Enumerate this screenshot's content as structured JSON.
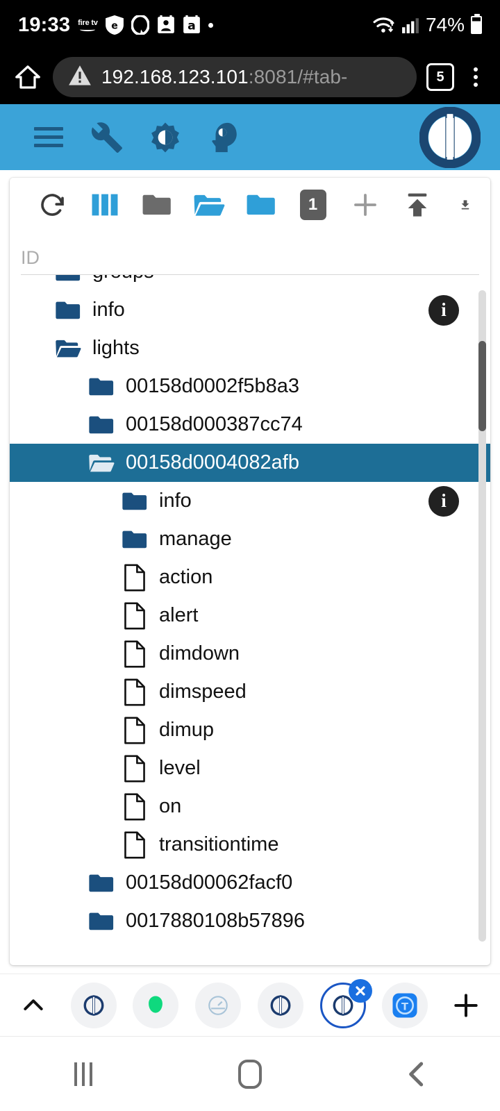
{
  "status_bar": {
    "clock": "19:33",
    "icons": [
      "firetv-icon",
      "shield-e-icon",
      "alexa-icon",
      "amazon-photos-icon",
      "amazon-a-icon",
      "dot-icon"
    ],
    "firetv_label": "fire tv",
    "wifi_icon": "wifi-icon",
    "signal_icon": "cellular-signal-icon",
    "battery_pct": "74%",
    "battery_icon": "battery-icon"
  },
  "browser": {
    "home_icon": "home-icon",
    "security_icon": "warning-triangle-icon",
    "url_host": "192.168.123.101",
    "url_rest": ":8081/#tab-",
    "tab_count": "5",
    "menu_icon": "kebab-menu-icon"
  },
  "app_header": {
    "menu_icon": "hamburger-menu-icon",
    "buttons": [
      {
        "name": "wrench-icon",
        "label": "Settings"
      },
      {
        "name": "brightness-icon",
        "label": "Theme"
      },
      {
        "name": "head-icon",
        "label": "Expert mode"
      }
    ],
    "logo_icon": "iobroker-logo-icon",
    "bg_color": "#3ba3d8",
    "icon_color": "#1d5b85"
  },
  "toolbar": {
    "items": [
      {
        "name": "refresh-icon",
        "label": "Refresh"
      },
      {
        "name": "columns-icon",
        "label": "Columns"
      },
      {
        "name": "folder-closed-icon",
        "label": "Collapse all"
      },
      {
        "name": "folder-open-icon",
        "label": "Expand all"
      },
      {
        "name": "folder-filled-icon",
        "label": "Expand one"
      },
      {
        "name": "depth-badge",
        "label": "1"
      },
      {
        "name": "plus-icon",
        "label": "Add object"
      },
      {
        "name": "upload-icon",
        "label": "Import"
      },
      {
        "name": "download-icon",
        "label": "Export"
      }
    ],
    "depth_value": "1",
    "accent_color": "#2f9fd8"
  },
  "filter": {
    "id_placeholder": "ID",
    "id_value": ""
  },
  "tree": {
    "scrollbar": "vertical-scrollbar",
    "rows": [
      {
        "label": "groups",
        "icon": "folder-closed-icon",
        "indent": 0,
        "selected": false,
        "info": false
      },
      {
        "label": "info",
        "icon": "folder-closed-icon",
        "indent": 0,
        "selected": false,
        "info": true
      },
      {
        "label": "lights",
        "icon": "folder-open-icon",
        "indent": 0,
        "selected": false,
        "info": false
      },
      {
        "label": "00158d0002f5b8a3",
        "icon": "folder-closed-icon",
        "indent": 1,
        "selected": false,
        "info": false
      },
      {
        "label": "00158d000387cc74",
        "icon": "folder-closed-icon",
        "indent": 1,
        "selected": false,
        "info": false
      },
      {
        "label": "00158d0004082afb",
        "icon": "folder-open-icon",
        "indent": 1,
        "selected": true,
        "info": false
      },
      {
        "label": "info",
        "icon": "folder-closed-icon",
        "indent": 2,
        "selected": false,
        "info": true
      },
      {
        "label": "manage",
        "icon": "folder-closed-icon",
        "indent": 2,
        "selected": false,
        "info": false
      },
      {
        "label": "action",
        "icon": "file-icon",
        "indent": 2,
        "selected": false,
        "info": false
      },
      {
        "label": "alert",
        "icon": "file-icon",
        "indent": 2,
        "selected": false,
        "info": false
      },
      {
        "label": "dimdown",
        "icon": "file-icon",
        "indent": 2,
        "selected": false,
        "info": false
      },
      {
        "label": "dimspeed",
        "icon": "file-icon",
        "indent": 2,
        "selected": false,
        "info": false
      },
      {
        "label": "dimup",
        "icon": "file-icon",
        "indent": 2,
        "selected": false,
        "info": false
      },
      {
        "label": "level",
        "icon": "file-icon",
        "indent": 2,
        "selected": false,
        "info": false
      },
      {
        "label": "on",
        "icon": "file-icon",
        "indent": 2,
        "selected": false,
        "info": false
      },
      {
        "label": "transitiontime",
        "icon": "file-icon",
        "indent": 2,
        "selected": false,
        "info": false
      },
      {
        "label": "00158d00062facf0",
        "icon": "folder-closed-icon",
        "indent": 1,
        "selected": false,
        "info": false
      },
      {
        "label": "0017880108b57896",
        "icon": "folder-closed-icon",
        "indent": 1,
        "selected": false,
        "info": false
      }
    ],
    "folder_color": "#1b4f7e",
    "selected_bg": "#1d6e96"
  },
  "tabstrip": {
    "expand_icon": "chevron-up-icon",
    "tabs": [
      {
        "name": "tab-iobroker-1",
        "icon": "iobroker-favicon",
        "active": false
      },
      {
        "name": "tab-green",
        "icon": "green-shield-favicon",
        "active": false
      },
      {
        "name": "tab-gauge",
        "icon": "gauge-favicon",
        "active": false
      },
      {
        "name": "tab-iobroker-2",
        "icon": "iobroker-favicon",
        "active": false
      },
      {
        "name": "tab-iobroker-3",
        "icon": "iobroker-favicon",
        "active": true
      },
      {
        "name": "tab-tasmota",
        "icon": "tasmota-favicon",
        "active": false
      }
    ],
    "close_icon": "close-x-icon",
    "new_tab_icon": "plus-icon",
    "active_color": "#1a56c4"
  },
  "navbar": {
    "recents_icon": "recents-icon",
    "home_icon": "home-square-icon",
    "back_icon": "back-chevron-icon"
  }
}
